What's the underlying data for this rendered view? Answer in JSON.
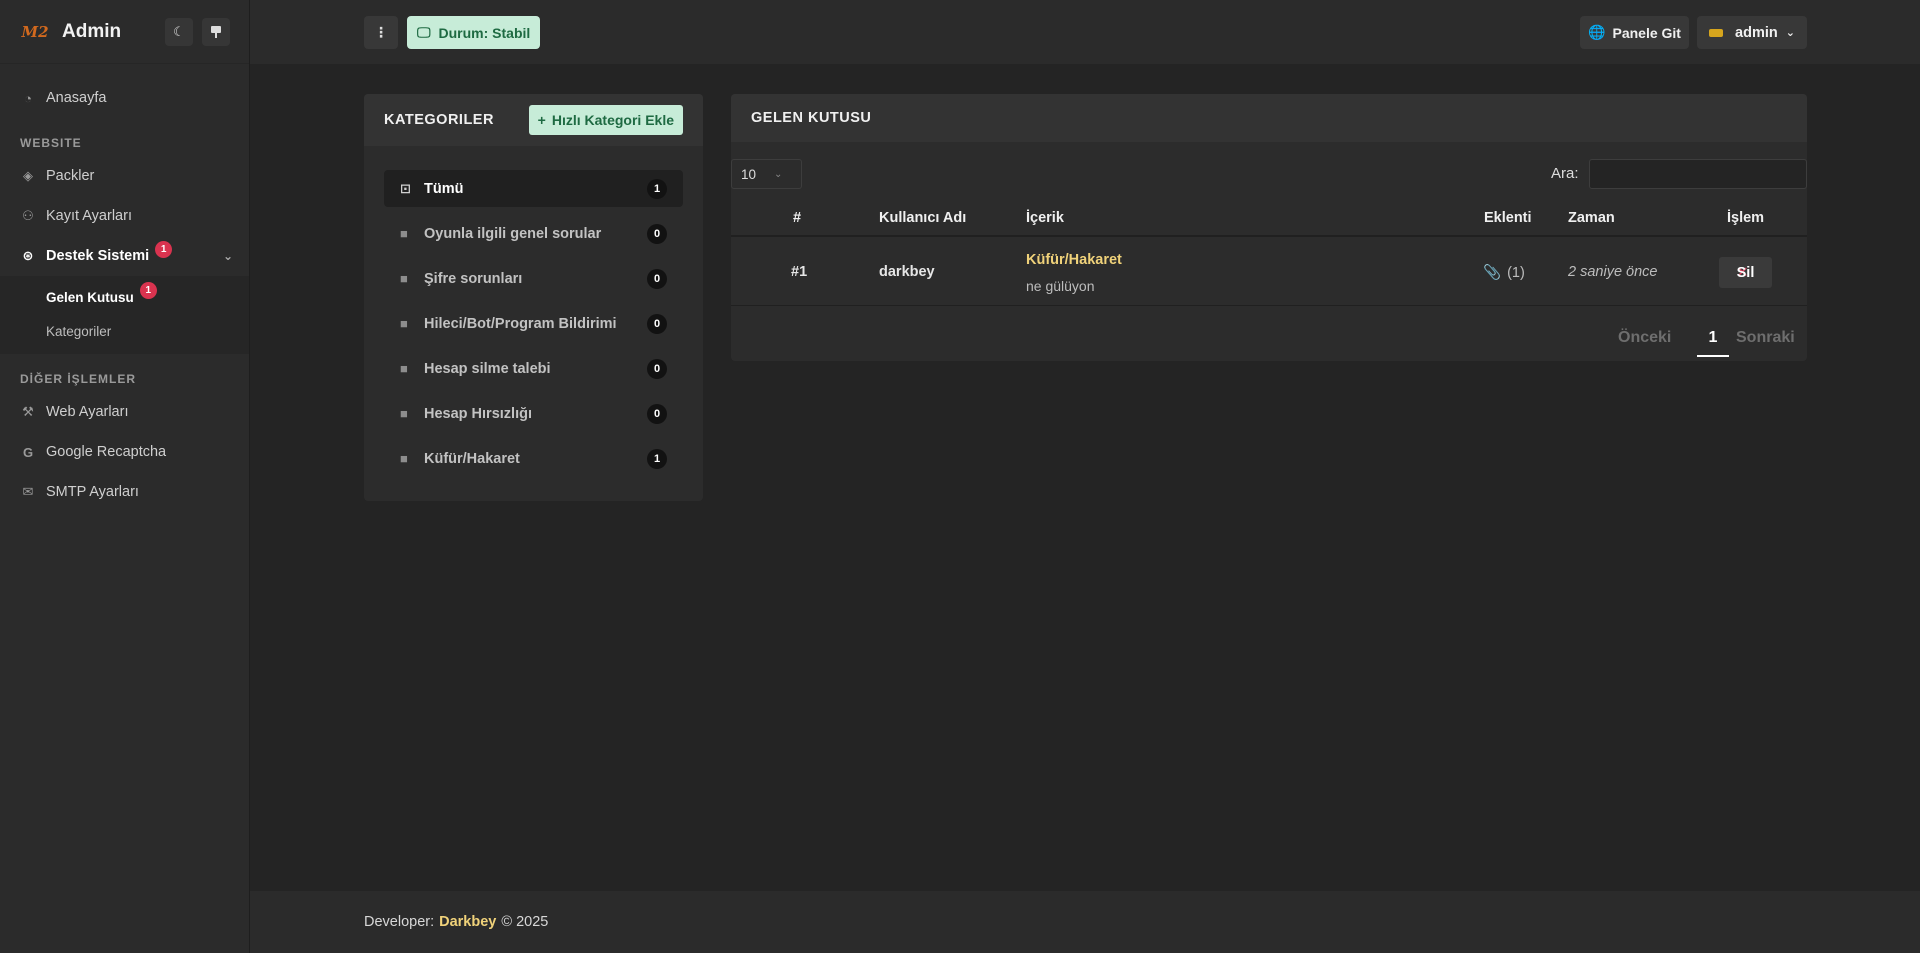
{
  "brand": {
    "logo_text": "M2",
    "name": "Admin"
  },
  "sidebar": {
    "home": "Anasayfa",
    "section_website": "WEBSITE",
    "items_website": [
      {
        "label": "Packler",
        "icon": "layers-icon"
      },
      {
        "label": "Kayıt Ayarları",
        "icon": "user-icon"
      },
      {
        "label": "Destek Sistemi",
        "icon": "lifebuoy-icon",
        "badge": "1"
      }
    ],
    "submenu": [
      {
        "label": "Gelen Kutusu",
        "badge": "1"
      },
      {
        "label": "Kategoriler"
      }
    ],
    "section_other": "DİĞER İŞLEMLER",
    "items_other": [
      {
        "label": "Web Ayarları",
        "icon": "wrench-icon"
      },
      {
        "label": "Google Recaptcha",
        "icon": "google-icon"
      },
      {
        "label": "SMTP Ayarları",
        "icon": "mail-icon"
      }
    ]
  },
  "header": {
    "status_label": "Durum: Stabil",
    "panel_label": "Panele Git",
    "user_name": "admin"
  },
  "categories": {
    "title": "KATEGORILER",
    "add_label": "Hızlı Kategori Ekle",
    "items": [
      {
        "label": "Tümü",
        "count": "1"
      },
      {
        "label": "Oyunla ilgili genel sorular",
        "count": "0"
      },
      {
        "label": "Şifre sorunları",
        "count": "0"
      },
      {
        "label": "Hileci/Bot/Program Bildirimi",
        "count": "0"
      },
      {
        "label": "Hesap silme talebi",
        "count": "0"
      },
      {
        "label": "Hesap Hırsızlığı",
        "count": "0"
      },
      {
        "label": "Küfür/Hakaret",
        "count": "1"
      }
    ]
  },
  "inbox": {
    "title": "GELEN KUTUSU",
    "page_length": "10",
    "search_label": "Ara:",
    "search_value": "",
    "columns": [
      "#",
      "Kullanıcı Adı",
      "İçerik",
      "Eklenti",
      "Zaman",
      "İşlem"
    ],
    "rows": [
      {
        "id": "#1",
        "username": "darkbey",
        "subject": "Küfür/Hakaret",
        "snippet": "ne gülüyon",
        "attachments": "(1)",
        "time": "2 saniye önce",
        "action": "Sil"
      }
    ],
    "pager": {
      "prev": "Önceki",
      "current": "1",
      "next": "Sonraki"
    }
  },
  "footer": {
    "prefix": "Developer:",
    "developer": "Darkbey",
    "suffix": "© 2025"
  },
  "colors": {
    "accent_green_bg": "#c7ecd8",
    "accent_green_text": "#1e6a42",
    "badge_red": "#d9334f",
    "highlight_gold": "#f0d27a"
  }
}
